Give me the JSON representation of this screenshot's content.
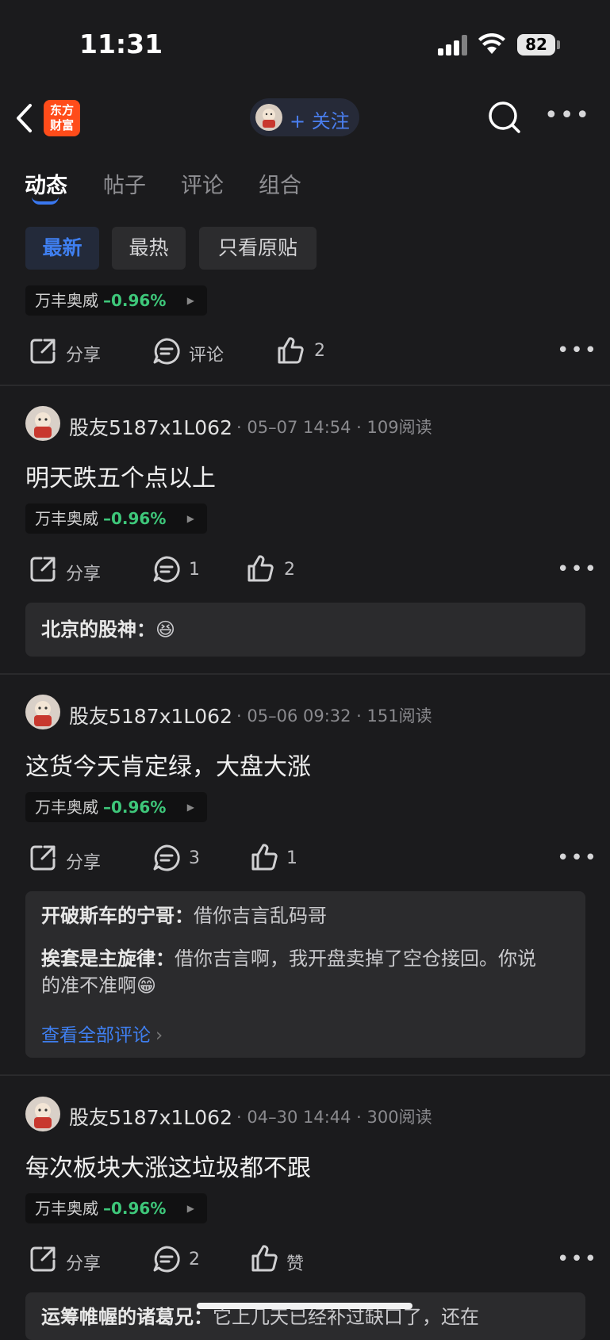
{
  "status_bar": {
    "time": "11:31",
    "battery": "82"
  },
  "header": {
    "logo_line1": "东方",
    "logo_line2": "财富",
    "follow_label": "+ 关注"
  },
  "tabs": [
    {
      "label": "动态",
      "active": true
    },
    {
      "label": "帖子"
    },
    {
      "label": "评论"
    },
    {
      "label": "组合"
    }
  ],
  "filters": [
    {
      "label": "最新",
      "active": true
    },
    {
      "label": "最热"
    },
    {
      "label": "只看原贴"
    }
  ],
  "stock": {
    "name": "万丰奥威",
    "change": "–0.96%"
  },
  "actions": {
    "share": "分享",
    "comment": "评论",
    "like_word": "赞"
  },
  "top_partial_post": {
    "like_count": "2"
  },
  "posts": [
    {
      "author": "股友5187x1L062",
      "time": "05–07 14:54",
      "reads": "109阅读",
      "text": "明天跌五个点以上",
      "comment_count": "1",
      "like_count": "2",
      "comments": [
        {
          "author": "北京的股神：",
          "body": "😆"
        }
      ]
    },
    {
      "author": "股友5187x1L062",
      "time": "05–06 09:32",
      "reads": "151阅读",
      "text": "这货今天肯定绿，大盘大涨",
      "comment_count": "3",
      "like_count": "1",
      "comments": [
        {
          "author": "开破斯车的宁哥：",
          "body": "借你吉言乱码哥"
        },
        {
          "author": "挨套是主旋律：",
          "body": "借你吉言啊，我开盘卖掉了空仓接回。你说的准不准啊😁"
        }
      ],
      "view_all": "查看全部评论"
    },
    {
      "author": "股友5187x1L062",
      "time": "04–30 14:44",
      "reads": "300阅读",
      "text": "每次板块大涨这垃圾都不跟",
      "comment_count": "2",
      "like_count": "赞",
      "comments": [
        {
          "author": "运筹帷幄的诸葛兄：",
          "body": "它上几天已经补过缺口了，还在"
        }
      ]
    }
  ]
}
